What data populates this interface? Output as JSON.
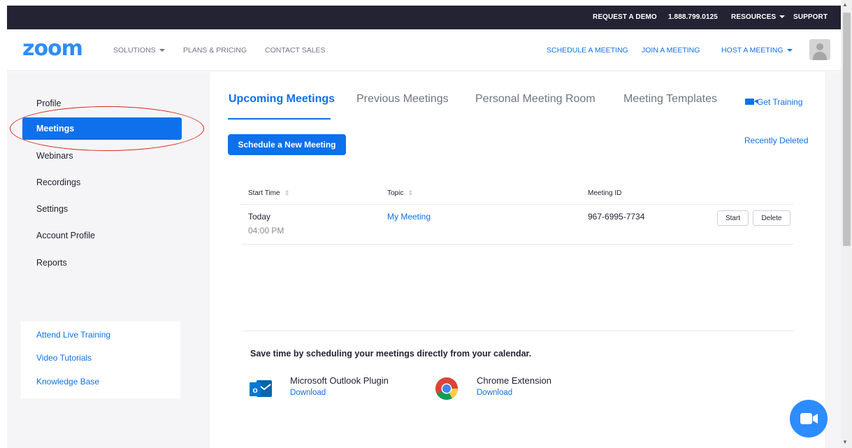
{
  "topbar": {
    "request_demo": "REQUEST A DEMO",
    "phone": "1.888.799.0125",
    "resources": "RESOURCES",
    "support": "SUPPORT"
  },
  "header": {
    "logo": "zoom",
    "solutions": "SOLUTIONS",
    "plans_pricing": "PLANS & PRICING",
    "contact_sales": "CONTACT SALES",
    "schedule_meeting": "SCHEDULE A MEETING",
    "join_meeting": "JOIN A MEETING",
    "host_meeting": "HOST A MEETING"
  },
  "sidebar": {
    "items": [
      {
        "label": "Profile"
      },
      {
        "label": "Meetings"
      },
      {
        "label": "Webinars"
      },
      {
        "label": "Recordings"
      },
      {
        "label": "Settings"
      },
      {
        "label": "Account Profile"
      },
      {
        "label": "Reports"
      }
    ],
    "active_item": "Meetings",
    "links": [
      {
        "label": "Attend Live Training"
      },
      {
        "label": "Video Tutorials"
      },
      {
        "label": "Knowledge Base"
      }
    ]
  },
  "main": {
    "tabs": [
      {
        "label": "Upcoming Meetings"
      },
      {
        "label": "Previous Meetings"
      },
      {
        "label": "Personal Meeting Room"
      },
      {
        "label": "Meeting Templates"
      }
    ],
    "active_tab": "Upcoming Meetings",
    "get_training": "Get Training",
    "schedule_button": "Schedule a New Meeting",
    "recently_deleted": "Recently Deleted",
    "table": {
      "headers": [
        "Start Time",
        "Topic",
        "Meeting ID"
      ],
      "rows": [
        {
          "day": "Today",
          "time": "04:00 PM",
          "topic": "My Meeting",
          "meeting_id": "967-6995-7734",
          "start_label": "Start",
          "delete_label": "Delete"
        }
      ]
    },
    "calendar": {
      "title": "Save time by scheduling your meetings directly from your calendar.",
      "plugins": [
        {
          "name": "Microsoft Outlook Plugin",
          "action": "Download",
          "icon": "outlook-icon"
        },
        {
          "name": "Chrome Extension",
          "action": "Download",
          "icon": "chrome-icon"
        }
      ]
    }
  },
  "colors": {
    "brand_blue": "#2d8cff",
    "link_blue": "#0e71eb",
    "topbar": "#232333",
    "annotation_red": "#d9281a"
  }
}
